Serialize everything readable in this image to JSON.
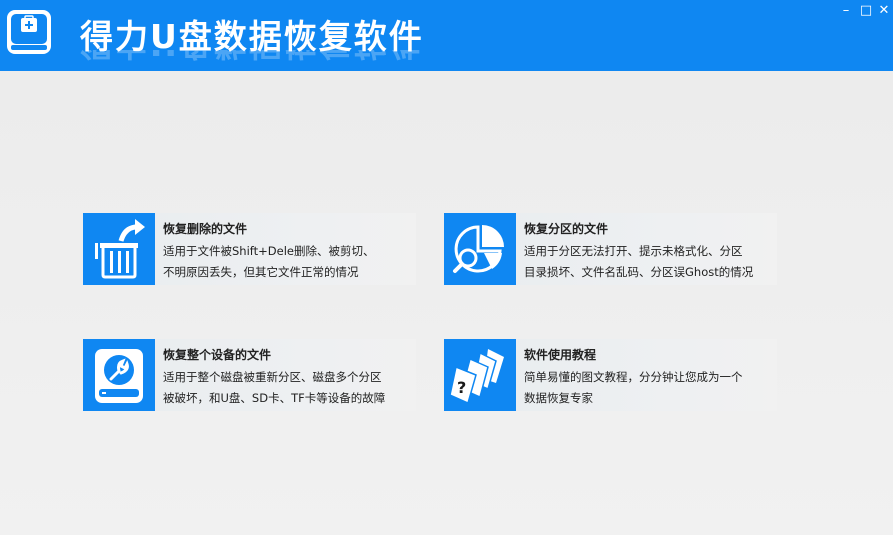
{
  "app": {
    "title": "得力U盘数据恢复软件"
  },
  "window_controls": {
    "minimize": "–",
    "maximize": "□",
    "close": "✕"
  },
  "cards": [
    {
      "title": "恢复删除的文件",
      "lines": [
        "适用于文件被Shift+Dele删除、被剪切、",
        "不明原因丢失，但其它文件正常的情况"
      ],
      "icon": "deleted-file-icon"
    },
    {
      "title": "恢复分区的文件",
      "lines": [
        "适用于分区无法打开、提示未格式化、分区",
        "目录损坏、文件名乱码、分区误Ghost的情况"
      ],
      "icon": "partition-pie-icon"
    },
    {
      "title": "恢复整个设备的文件",
      "lines": [
        "适用于整个磁盘被重新分区、磁盘多个分区",
        "被破坏，和U盘、SD卡、TF卡等设备的故障"
      ],
      "icon": "disk-wrench-icon"
    },
    {
      "title": "软件使用教程",
      "lines": [
        "简单易懂的图文教程，分分钟让您成为一个",
        "数据恢复专家"
      ],
      "icon": "tutorial-pages-icon"
    }
  ],
  "colors": {
    "accent": "#0f87f2",
    "background": "#efefef"
  }
}
